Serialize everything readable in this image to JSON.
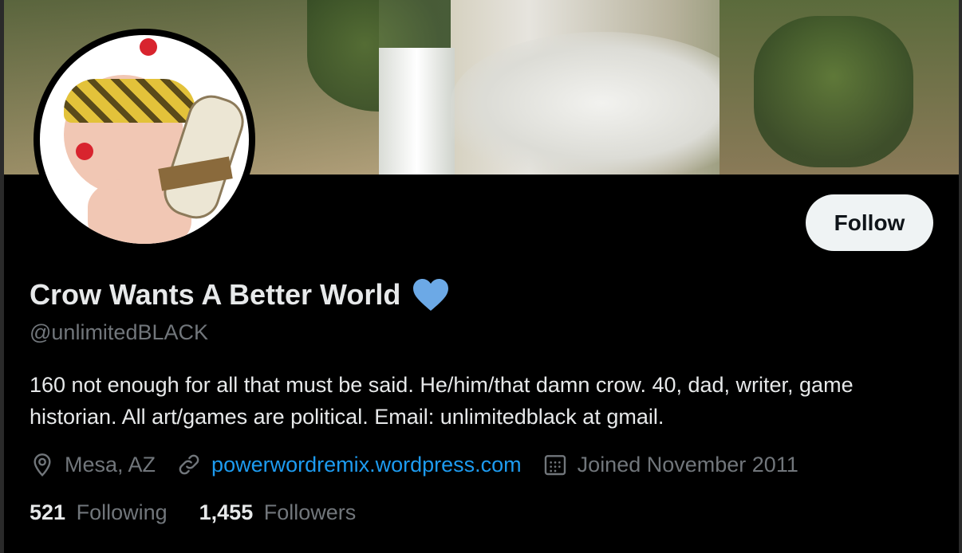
{
  "profile": {
    "display_name": "Crow Wants A Better World",
    "handle": "@unlimitedBLACK",
    "bio": "160 not enough for all that must be said. He/him/that damn crow. 40, dad, writer, game historian. All art/games are political. Email: unlimitedblack at gmail.",
    "location": "Mesa, AZ",
    "website": "powerwordremix.wordpress.com",
    "joined": "Joined November 2011",
    "badge_icon": "blue-heart-icon"
  },
  "actions": {
    "follow_label": "Follow"
  },
  "stats": {
    "following_count": "521",
    "following_label": "Following",
    "followers_count": "1,455",
    "followers_label": "Followers"
  },
  "icons": {
    "location": "location-pin-icon",
    "link": "link-icon",
    "calendar": "calendar-icon"
  },
  "colors": {
    "background": "#000000",
    "text_primary": "#e7e9ea",
    "text_secondary": "#71767b",
    "link": "#1d9bf0",
    "heart": "#6ca9e6",
    "follow_button_bg": "#eff3f4"
  }
}
